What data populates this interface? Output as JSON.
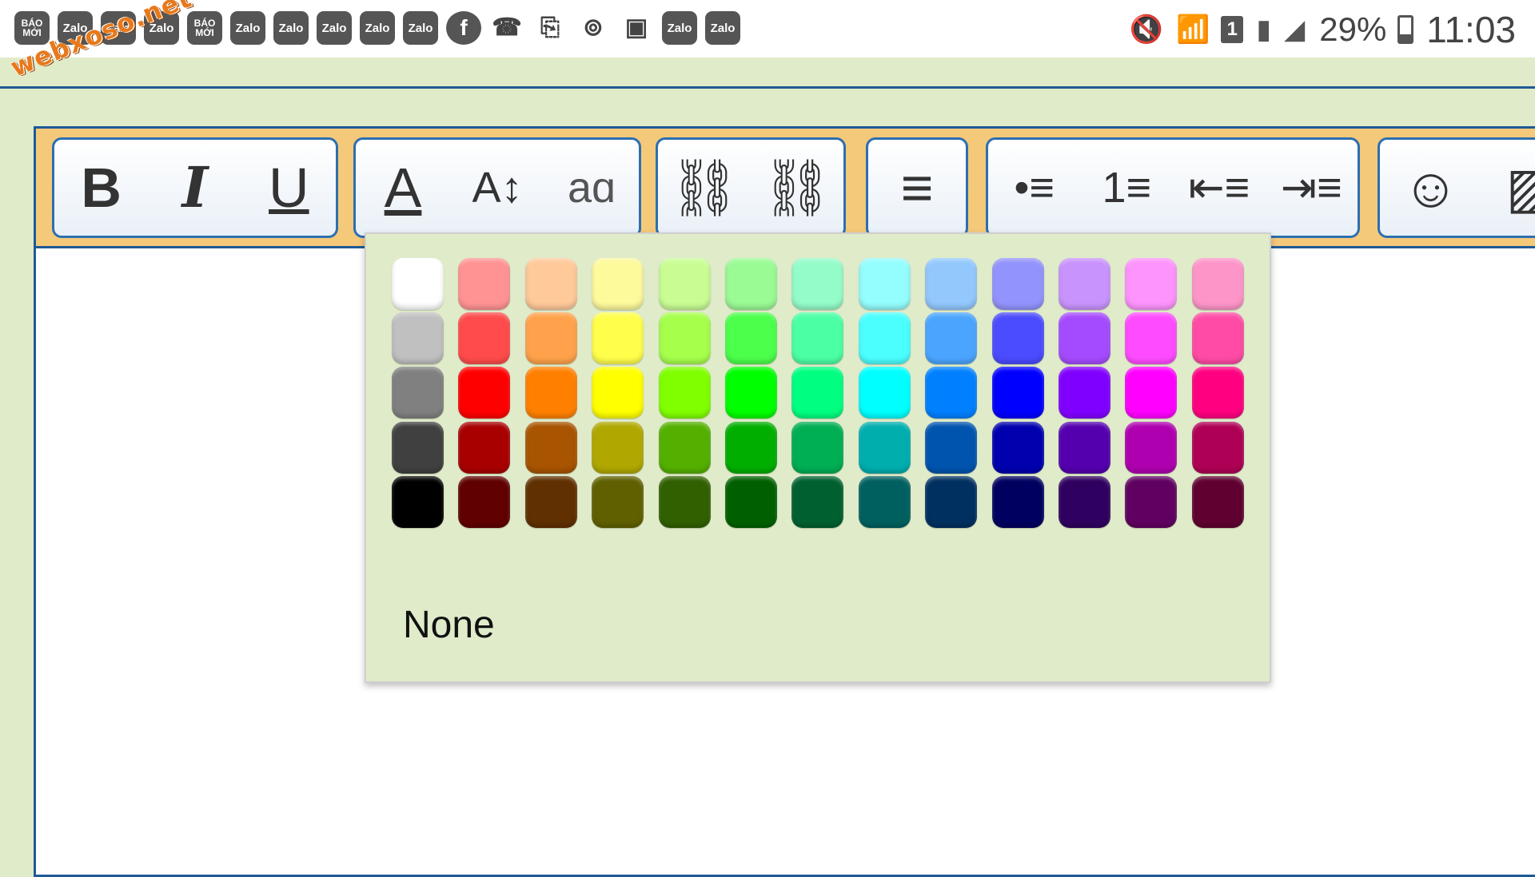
{
  "status_bar": {
    "notification_icons": [
      {
        "name": "baomoi-icon",
        "label": "BÁO MỚI"
      },
      {
        "name": "zalo-icon",
        "label": "Zalo"
      },
      {
        "name": "zalo-icon",
        "label": "Zalo"
      },
      {
        "name": "zalo-icon",
        "label": "Zalo"
      },
      {
        "name": "baomoi-icon",
        "label": "BÁO MỚI"
      },
      {
        "name": "zalo-icon",
        "label": "Zalo"
      },
      {
        "name": "zalo-icon",
        "label": "Zalo"
      },
      {
        "name": "zalo-icon",
        "label": "Zalo"
      },
      {
        "name": "zalo-icon",
        "label": "Zalo"
      },
      {
        "name": "zalo-icon",
        "label": "Zalo"
      },
      {
        "name": "facebook-icon",
        "label": "f"
      },
      {
        "name": "missed-call-icon",
        "label": "☎"
      },
      {
        "name": "clipboard-icon",
        "label": "⎘"
      },
      {
        "name": "voicemail-icon",
        "label": "⊚"
      },
      {
        "name": "gallery-icon",
        "label": "▣"
      },
      {
        "name": "zalo-icon",
        "label": "Zalo"
      },
      {
        "name": "zalo-icon",
        "label": "Zalo"
      }
    ],
    "watermark": "webxoso.net",
    "sim_slot": "1",
    "battery_percent": "29%",
    "battery_level": 0.29,
    "time": "11:03"
  },
  "toolbar": {
    "groups": [
      {
        "buttons": [
          {
            "name": "bold-button",
            "glyph": "B",
            "cls": "bold"
          },
          {
            "name": "italic-button",
            "glyph": "I",
            "cls": "italic"
          },
          {
            "name": "underline-button",
            "glyph": "U",
            "cls": "underline"
          }
        ]
      },
      {
        "buttons": [
          {
            "name": "text-color-button",
            "glyph": "A",
            "icon": "text-color-icon"
          },
          {
            "name": "font-size-button",
            "glyph": "A↕",
            "icon": "font-size-icon"
          },
          {
            "name": "font-family-button",
            "glyph": "aɑ",
            "icon": "font-family-icon"
          }
        ]
      },
      {
        "buttons": [
          {
            "name": "insert-link-button",
            "glyph": "⛓",
            "icon": "link-icon"
          },
          {
            "name": "remove-link-button",
            "glyph": "⛓",
            "icon": "unlink-icon"
          }
        ]
      },
      {
        "buttons": [
          {
            "name": "align-button",
            "glyph": "≡",
            "icon": "align-left-icon"
          }
        ]
      },
      {
        "buttons": [
          {
            "name": "bulleted-list-button",
            "glyph": "•≡",
            "icon": "bulleted-list-icon"
          },
          {
            "name": "numbered-list-button",
            "glyph": "1≡",
            "icon": "numbered-list-icon"
          },
          {
            "name": "outdent-button",
            "glyph": "⇤≡",
            "icon": "outdent-icon"
          },
          {
            "name": "indent-button",
            "glyph": "⇥≡",
            "icon": "indent-icon"
          }
        ]
      },
      {
        "buttons": [
          {
            "name": "emoji-button",
            "glyph": "☺",
            "icon": "smiley-icon"
          },
          {
            "name": "insert-image-button",
            "glyph": "▨",
            "icon": "image-icon"
          }
        ]
      }
    ]
  },
  "color_picker": {
    "none_label": "None",
    "rows": [
      [
        "#ffffff",
        "#ff9393",
        "#ffc99a",
        "#fdfa9b",
        "#c9fd94",
        "#9afb94",
        "#94fcc8",
        "#94fdfd",
        "#93c8fd",
        "#9393fd",
        "#c993fd",
        "#fd93fd",
        "#fd95c9"
      ],
      [
        "#c0c0c0",
        "#ff4b4b",
        "#ffa24b",
        "#fffe4b",
        "#a5ff4b",
        "#4bff4b",
        "#4bffa5",
        "#4bffff",
        "#4ba5ff",
        "#4b4bff",
        "#a54bff",
        "#ff4bff",
        "#ff4ba5"
      ],
      [
        "#808080",
        "#ff0000",
        "#ff8000",
        "#ffff00",
        "#80ff00",
        "#00ff00",
        "#00ff80",
        "#00ffff",
        "#0080ff",
        "#0000ff",
        "#8000ff",
        "#ff00ff",
        "#ff0080"
      ],
      [
        "#404040",
        "#a80000",
        "#a85400",
        "#b0a800",
        "#54b000",
        "#00ae00",
        "#00ae54",
        "#00aeae",
        "#0054ae",
        "#0000ae",
        "#5400ae",
        "#ae00ae",
        "#ae0054"
      ],
      [
        "#000000",
        "#600000",
        "#603000",
        "#606000",
        "#306000",
        "#006000",
        "#006030",
        "#006060",
        "#003060",
        "#000060",
        "#300060",
        "#600060",
        "#600030"
      ]
    ]
  }
}
